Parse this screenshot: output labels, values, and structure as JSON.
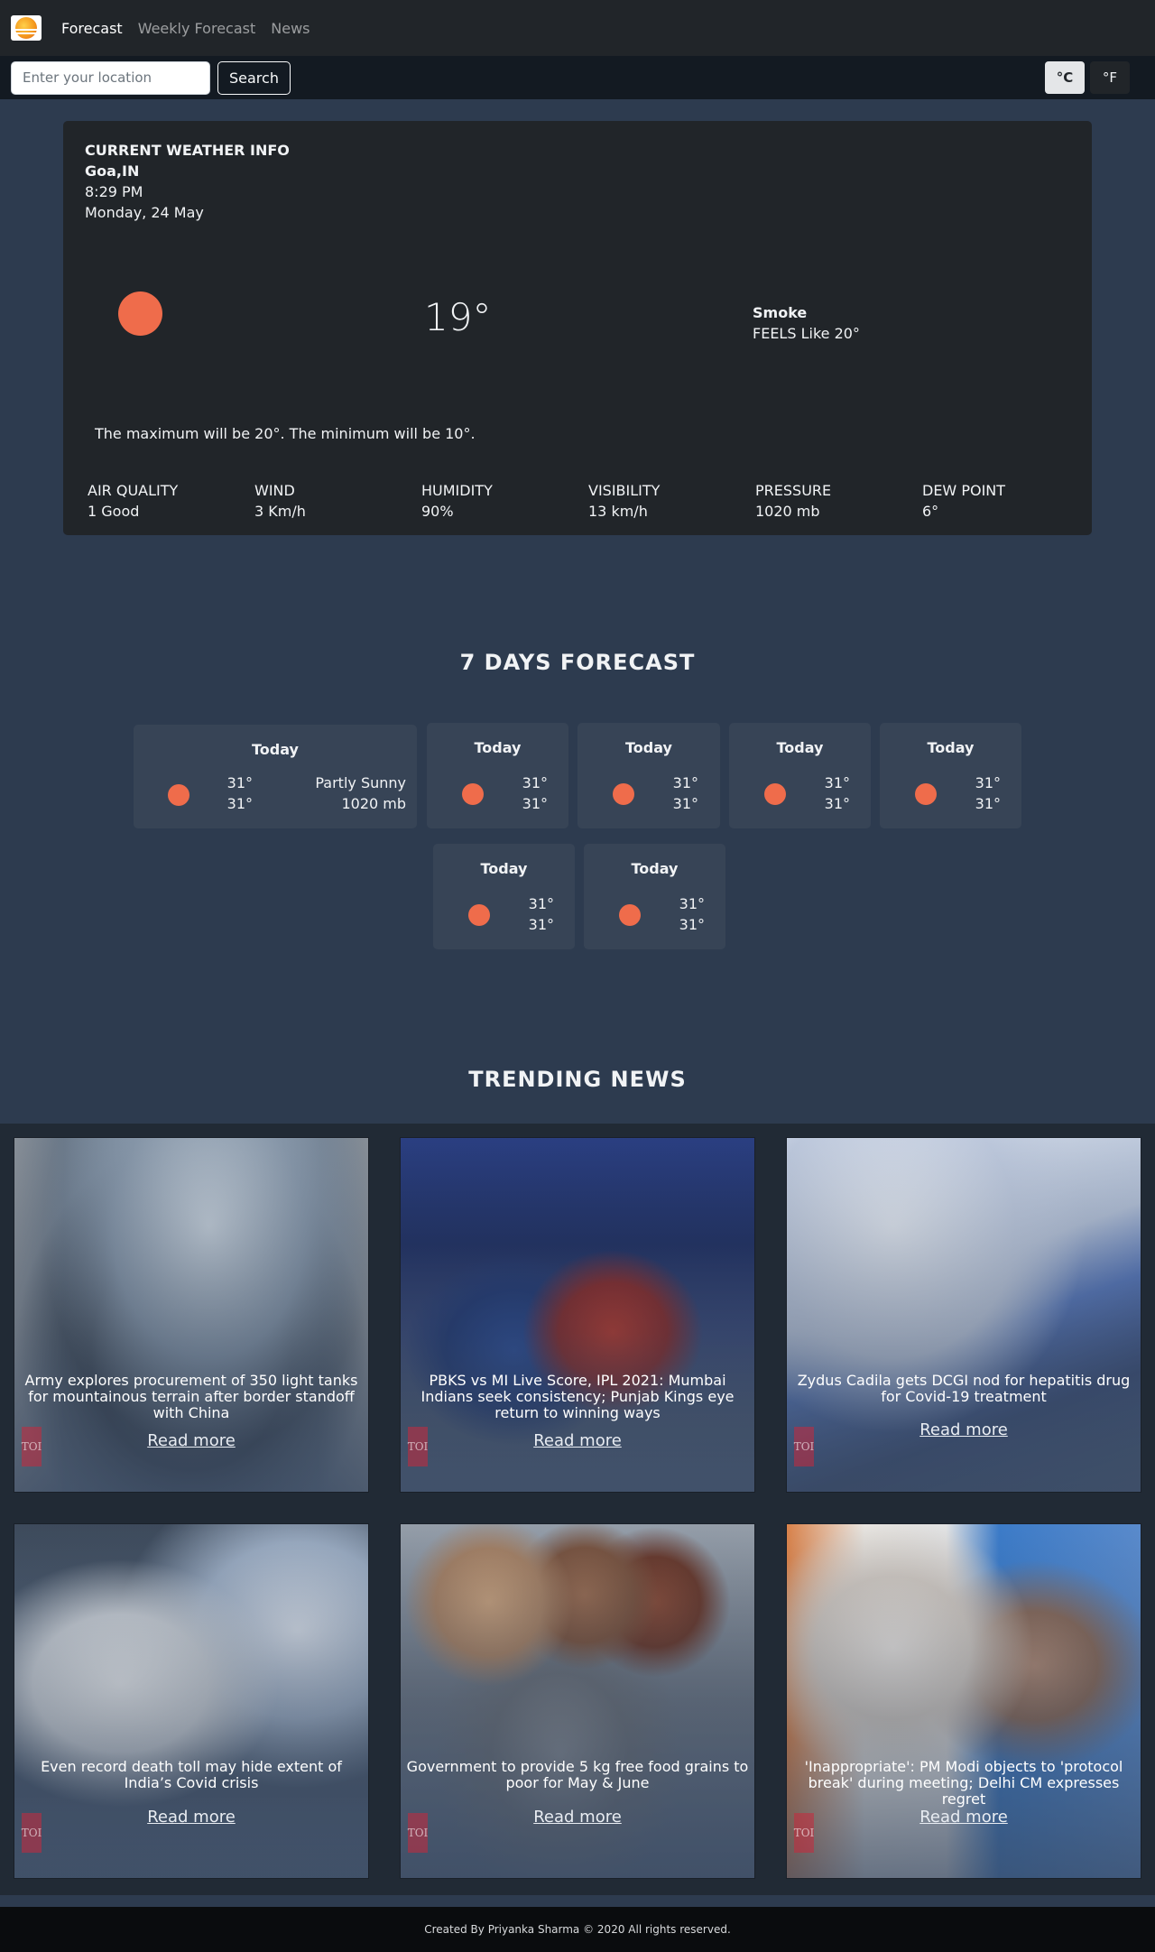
{
  "nav": {
    "links": [
      {
        "label": "Forecast"
      },
      {
        "label": "Weekly Forecast"
      },
      {
        "label": "News"
      }
    ]
  },
  "search": {
    "placeholder": "Enter your location",
    "button_label": "Search",
    "unit_celsius": "°C",
    "unit_fahrenheit": "°F"
  },
  "current": {
    "title": "CURRENT WEATHER INFO",
    "city": "Goa,IN",
    "time": "8:29 PM",
    "date": "Monday, 24 May",
    "temperature": "19°",
    "condition": "Smoke",
    "feels_like": "FEELS Like 20°",
    "minmax": "The maximum will be 20°. The minimum will be 10°.",
    "stats": [
      {
        "label": "AIR QUALITY",
        "value": "1 Good"
      },
      {
        "label": "WIND",
        "value": "3 Km/h"
      },
      {
        "label": "HUMIDITY",
        "value": "90%"
      },
      {
        "label": "VISIBILITY",
        "value": "13 km/h"
      },
      {
        "label": "PRESSURE",
        "value": "1020 mb"
      },
      {
        "label": "DEW POINT",
        "value": "6°"
      }
    ]
  },
  "forecast": {
    "title": "7 DAYS FORECAST",
    "days": [
      {
        "day": "Today",
        "high": "31°",
        "low": "31°",
        "desc": "Partly Sunny",
        "pressure": "1020 mb"
      },
      {
        "day": "Today",
        "high": "31°",
        "low": "31°"
      },
      {
        "day": "Today",
        "high": "31°",
        "low": "31°"
      },
      {
        "day": "Today",
        "high": "31°",
        "low": "31°"
      },
      {
        "day": "Today",
        "high": "31°",
        "low": "31°"
      },
      {
        "day": "Today",
        "high": "31°",
        "low": "31°"
      },
      {
        "day": "Today",
        "high": "31°",
        "low": "31°"
      }
    ]
  },
  "news": {
    "title": "TRENDING NEWS",
    "read_more": "Read more",
    "watermark": "TOI",
    "articles": [
      {
        "headline": "Army explores procurement of 350 light tanks for mountainous terrain after border standoff with China"
      },
      {
        "headline": "PBKS vs MI Live Score, IPL 2021: Mumbai Indians seek consistency; Punjab Kings eye return to winning ways"
      },
      {
        "headline": "Zydus Cadila gets DCGI nod for hepatitis drug for Covid-19 treatment"
      },
      {
        "headline": "Even record death toll may hide extent of India’s Covid crisis"
      },
      {
        "headline": "Government to provide 5 kg free food grains to poor for May & June"
      },
      {
        "headline": "'Inappropriate': PM Modi objects to 'protocol break' during meeting; Delhi CM expresses regret"
      }
    ]
  },
  "footer": {
    "text": "Created By Priyanka Sharma © 2020 All rights reserved."
  },
  "colors": {
    "page_bg": "#2d3b4f",
    "card_bg": "#212529",
    "forecast_card_bg": "#374456",
    "sun": "#ef6c4b"
  }
}
